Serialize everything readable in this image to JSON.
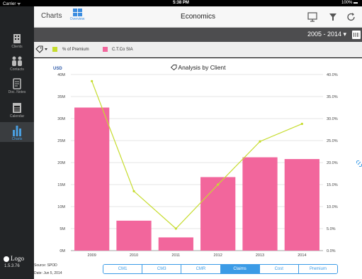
{
  "status_bar": {
    "carrier": "Carrier ᯤ",
    "time": "5:38 PM",
    "battery": "100% ▬"
  },
  "sidebar": {
    "items": [
      {
        "label": "Clients",
        "icon": "building-icon"
      },
      {
        "label": "Contacts",
        "icon": "people-icon"
      },
      {
        "label": "Doc. Notes",
        "icon": "notes-icon"
      },
      {
        "label": "Calendar",
        "icon": "calendar-icon"
      },
      {
        "label": "Charts",
        "icon": "bar-chart-icon",
        "active": true
      }
    ],
    "logo_text": "Logo",
    "version": "1.5.3.76"
  },
  "header": {
    "charts_label": "Charts",
    "overview_label": "Overview",
    "title": "Economics"
  },
  "toolbar": {
    "period": "2005 - 2014 ▾"
  },
  "legend": {
    "items": [
      {
        "label": "% of Premium",
        "color": "#c6dc2e"
      },
      {
        "label": "C.T.Co SIA",
        "color": "#f2669c"
      }
    ]
  },
  "chart_data": {
    "type": "bar",
    "title": "Analysis by Client",
    "ylabel": "USD",
    "categories": [
      "2009",
      "2010",
      "2011",
      "2012",
      "2013",
      "2014"
    ],
    "ylim": [
      0,
      40000000
    ],
    "y_ticks": [
      "0M",
      "5M",
      "10M",
      "15M",
      "20M",
      "25M",
      "30M",
      "35M",
      "40M"
    ],
    "y2lim": [
      0,
      40
    ],
    "y2_ticks": [
      "0.0%",
      "5.0%",
      "10.0%",
      "15.0%",
      "20.0%",
      "25.0%",
      "30.0%",
      "35.0%",
      "40.0%"
    ],
    "series": [
      {
        "name": "C.T.Co SIA",
        "type": "bar",
        "axis": "left",
        "color": "#f2669c",
        "values": [
          32500000,
          6800000,
          3000000,
          16700000,
          21200000,
          20800000
        ]
      },
      {
        "name": "% of Premium",
        "type": "line",
        "axis": "right",
        "color": "#c6dc2e",
        "values": [
          38.5,
          13.5,
          5.0,
          15.0,
          24.8,
          28.8
        ]
      }
    ],
    "grid": true
  },
  "footer": {
    "source": "Source: SPOD",
    "date": "Date: Jun 5, 2014",
    "tabs": [
      "CM1",
      "CM3",
      "CMR",
      "Claims",
      "Cost",
      "Premium"
    ],
    "active_tab": "Claims"
  },
  "colors": {
    "accent": "#3b9be6",
    "bar": "#f2669c",
    "line": "#c6dc2e"
  }
}
